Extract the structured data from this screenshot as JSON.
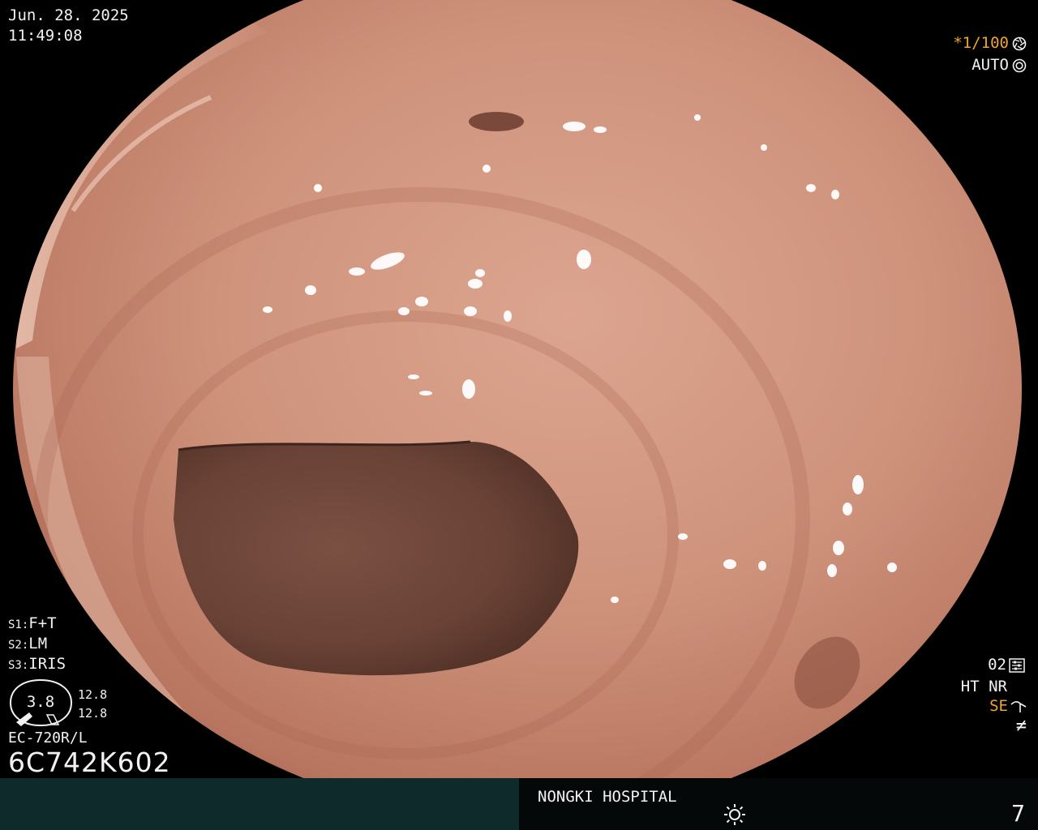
{
  "overlay": {
    "date": "Jun. 28. 2025",
    "time": "11:49:08",
    "shutter": "*1/100",
    "shutter_icon": "aperture-icon",
    "exposure_mode": "AUTO",
    "exposure_icon": "iris-icon",
    "settings": [
      {
        "prefix": "S1:",
        "value": "F+T"
      },
      {
        "prefix": "S2:",
        "value": "LM"
      },
      {
        "prefix": "S3:",
        "value": "IRIS"
      }
    ],
    "gauge_value": "3.8",
    "gauge_top": "12.8",
    "gauge_bottom": "12.8",
    "scope_model": "EC-720R/L",
    "serial": "6C742K602",
    "right_status": {
      "level": "02",
      "level_icon": "enhancement-level-icon",
      "line2": "HT NR",
      "se": "SE",
      "se_icon": "structure-enhance-icon",
      "bottom_icon": "not-equal-icon"
    },
    "hospital": "NONGKI HOSPITAL",
    "brightness_icon": "sun-icon",
    "page_number": "7"
  },
  "colors": {
    "background": "#000000",
    "overlay_text": "#f2f2f2",
    "highlight": "#f0a52a",
    "bottom_bar_left": "#0f2a2a",
    "bottom_bar_right": "#050808",
    "mucosa": "#c98b75",
    "lumen": "#5a3a30"
  }
}
